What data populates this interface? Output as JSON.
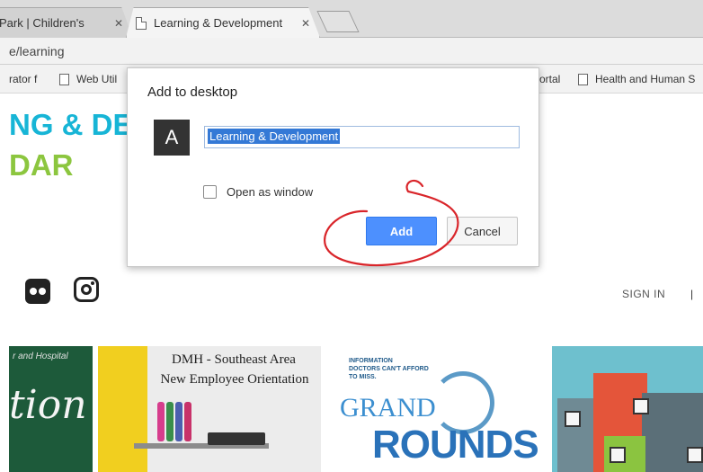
{
  "browser": {
    "tabs": [
      {
        "label": "Park | Children's",
        "close": "✕",
        "active": false
      },
      {
        "label": "Learning & Development",
        "close": "✕",
        "active": true
      }
    ],
    "url": "e/learning",
    "bookmarks": [
      {
        "label": "rator f"
      },
      {
        "label": "Web Util"
      },
      {
        "label": "ortal"
      },
      {
        "label": "Health and Human S"
      }
    ]
  },
  "page": {
    "hero_line1": "NG & DE",
    "hero_line2": "DAR",
    "sign_in": "SIGN IN",
    "separator": "|",
    "tiles": {
      "tile1_small": "r and Hospital",
      "tile1_big": "tion",
      "tile2_line1": "DMH - Southeast Area",
      "tile2_line2": "New Employee Orientation",
      "tile3_small": "INFORMATION\nDOCTORS CAN'T AFFORD\nTO MISS.",
      "tile3_grand": "GRAND",
      "tile3_rounds": "ROUNDS"
    }
  },
  "dialog": {
    "title": "Add to desktop",
    "icon_letter": "A",
    "name_value": "Learning & Development",
    "open_as_window_label": "Open as window",
    "open_as_window_checked": false,
    "add_label": "Add",
    "cancel_label": "Cancel"
  },
  "colors": {
    "accent_blue": "#4d90fe",
    "hero_teal": "#17b5d6",
    "hero_green": "#8cc63f",
    "annotation_red": "#d9252a"
  }
}
